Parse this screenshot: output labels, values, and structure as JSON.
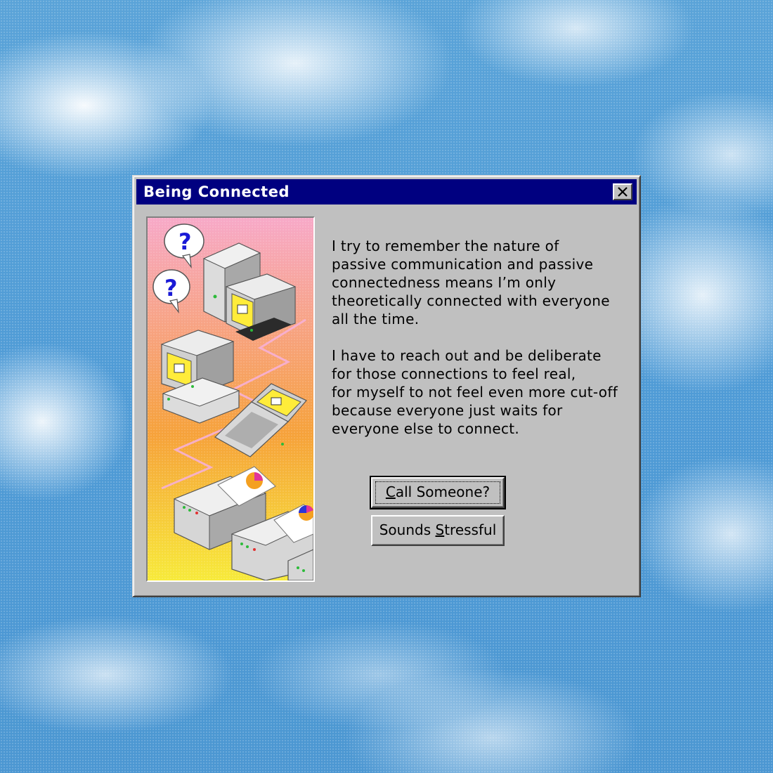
{
  "window": {
    "title": "Being Connected"
  },
  "message": {
    "paragraph1": [
      "I try to remember the nature of",
      "passive communication and passive",
      "connectedness means I’m only",
      "theoretically connected with everyone",
      "all the time."
    ],
    "paragraph2": [
      "I have to reach out and be deliberate",
      "for those connections to feel real,",
      "for myself to not feel even more cut-off",
      "because everyone just waits for",
      "everyone else to connect."
    ]
  },
  "buttons": {
    "primary": {
      "label": "Call Someone?",
      "mnemonic": "C",
      "rest": "all Someone?"
    },
    "secondary": {
      "label": "Sounds Stressful",
      "before": "Sounds ",
      "mnemonic": "S",
      "rest": "tressful"
    }
  },
  "illustration": {
    "subjects": [
      "speech-bubble-question-icon",
      "desktop-computer-icon",
      "laptop-icon",
      "printer-icon"
    ],
    "bubble_text": "?"
  },
  "colors": {
    "titlebar": "#000080",
    "window": "#c0c0c0",
    "sky": "#4f9bd6",
    "illustration_top": "#f7a6c4",
    "illustration_mid": "#f6a23a",
    "illustration_bottom": "#f7e63a"
  }
}
